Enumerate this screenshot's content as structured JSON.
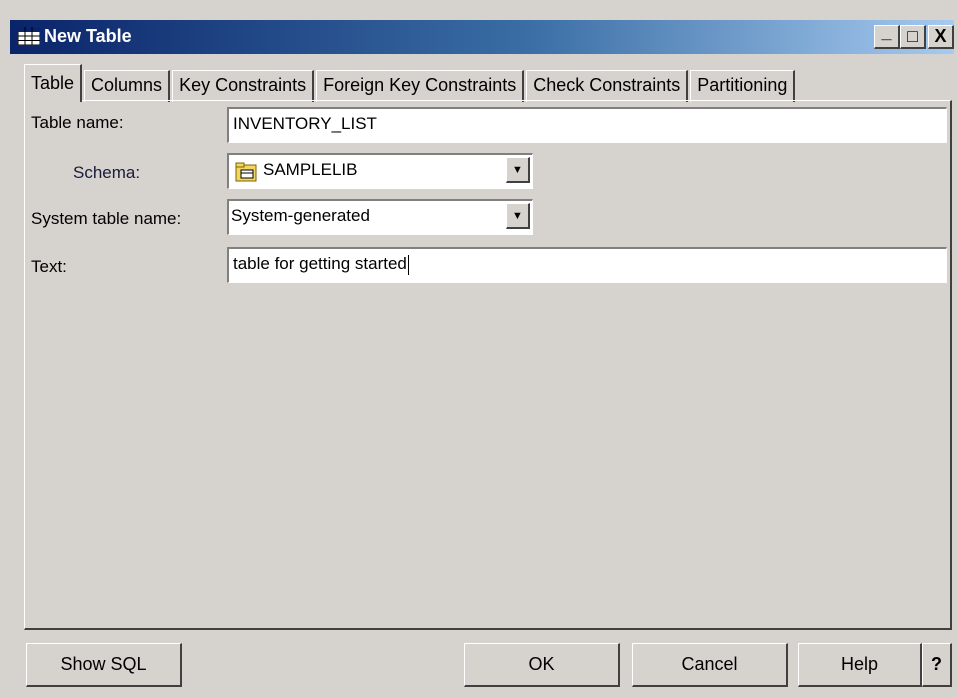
{
  "window": {
    "title": "New Table",
    "minimize_label": "_",
    "maximize_label": "□",
    "close_label": "X"
  },
  "tabs": [
    {
      "label": "Table",
      "active": true
    },
    {
      "label": "Columns"
    },
    {
      "label": "Key Constraints"
    },
    {
      "label": "Foreign Key Constraints"
    },
    {
      "label": "Check Constraints"
    },
    {
      "label": "Partitioning"
    }
  ],
  "form": {
    "table_name_label": "Table name:",
    "table_name_value": "INVENTORY_LIST",
    "schema_label": "Schema:",
    "schema_value": "SAMPLELIB",
    "system_table_name_label": "System table name:",
    "system_table_name_value": "System-generated",
    "text_label": "Text:",
    "text_value": "table for getting started"
  },
  "buttons": {
    "show_sql": "Show SQL",
    "ok": "OK",
    "cancel": "Cancel",
    "help": "Help",
    "question": "?"
  },
  "icons": {
    "title": "table-icon",
    "schema": "folder-library-icon",
    "dropdown": "chevron-down-icon"
  },
  "colors": {
    "titlebar_start": "#0a246a",
    "titlebar_end": "#a6caf0",
    "face": "#d6d3ce"
  }
}
